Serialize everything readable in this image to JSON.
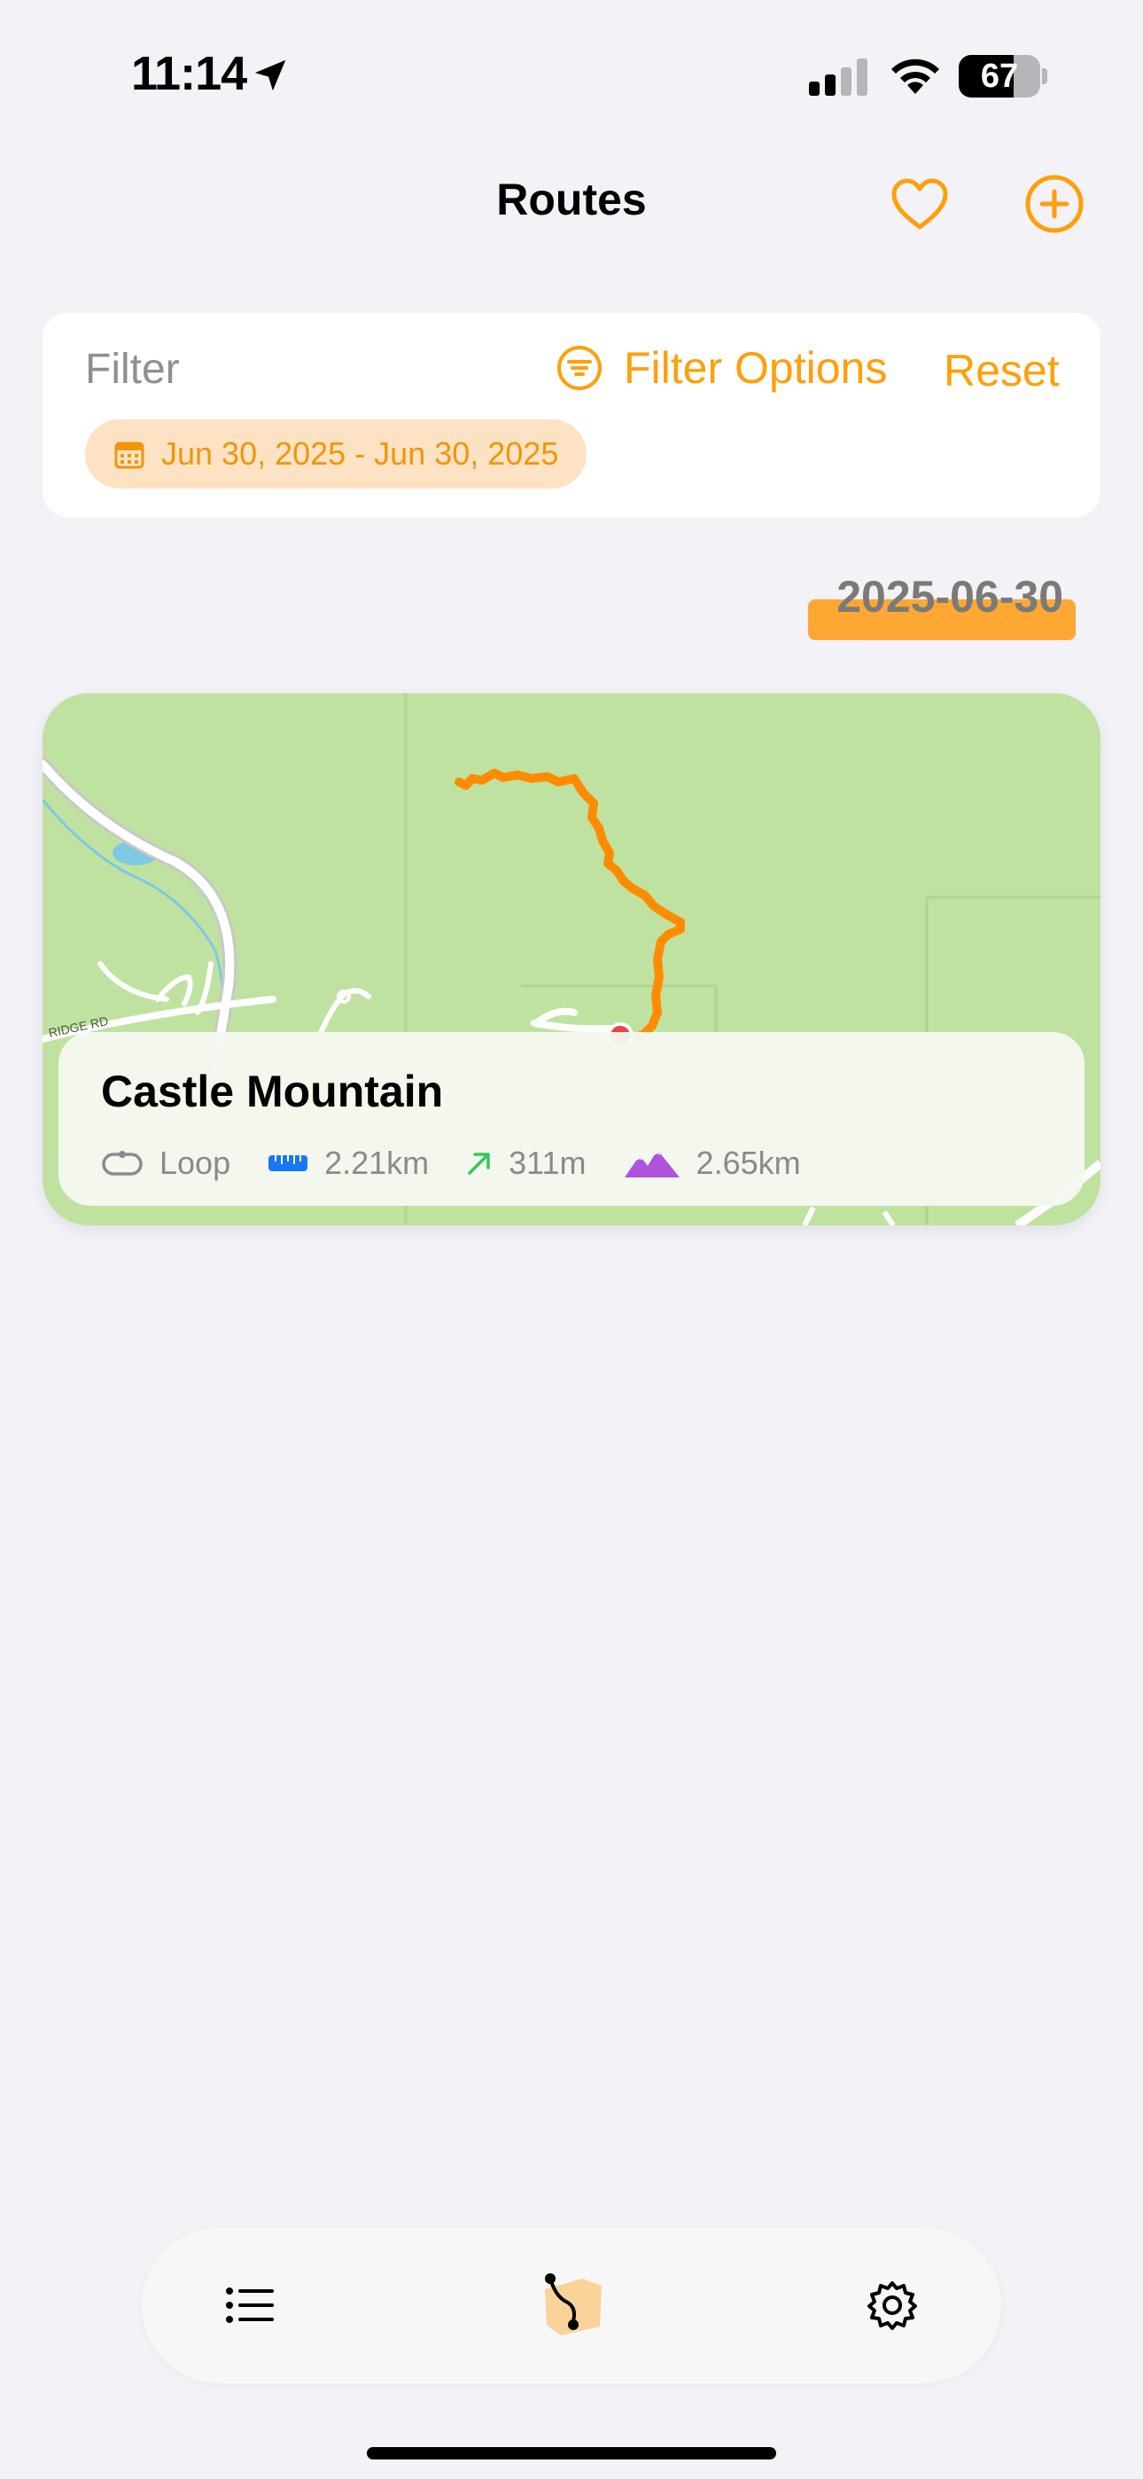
{
  "status_bar": {
    "time": "11:14",
    "battery_percent": 67,
    "battery_label": "67",
    "icons": [
      "location-arrow-icon",
      "cellular-signal-icon",
      "wifi-icon",
      "battery-icon"
    ]
  },
  "nav": {
    "title": "Routes",
    "favorite_icon": "heart-icon",
    "add_icon": "plus-circle-icon"
  },
  "filter": {
    "label": "Filter",
    "options_label": "Filter Options",
    "reset_label": "Reset",
    "date_range": "Jun 30, 2025 - Jun 30, 2025"
  },
  "section": {
    "date": "2025-06-30"
  },
  "route": {
    "name": "Castle Mountain",
    "map_road_label": "RIDGE RD",
    "type": "Loop",
    "distance": "2.21km",
    "elevation_gain": "311m",
    "ascent_distance": "2.65km"
  },
  "tab_bar": {
    "tabs": [
      "list-icon",
      "route-icon",
      "gear-icon"
    ],
    "selected": "route-icon"
  },
  "colors": {
    "accent": "#ff9f0a",
    "route_line": "#ff8c00",
    "map_green": "#bfe2a0",
    "distance_icon": "#1877f2",
    "gain_icon": "#34c759",
    "mountain_icon": "#af52de"
  }
}
